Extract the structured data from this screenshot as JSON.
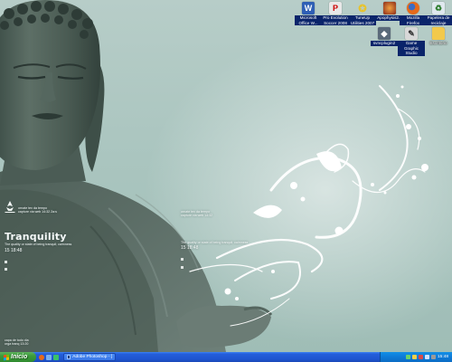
{
  "widgets": {
    "left": {
      "tiny_top_1": "ornate tex da tempo",
      "tiny_top_2": "capture via web 14:32 2a:s",
      "title": "Tranquility",
      "subtitle": "The quality or state of being tranquil; calmness",
      "clock": "15  18:48",
      "tiny_bottom_1": "capa de todo dia",
      "tiny_bottom_2": "orga tranq 13:20"
    },
    "mid": {
      "tiny_top_1": "ornate tex da tempo",
      "tiny_top_2": "capture via web 14:32",
      "subtitle": "The quality or state of being tranquil; calmness",
      "clock": "15  18:48"
    }
  },
  "desktop_icons": [
    {
      "id": "msoffice",
      "label": "Microsoft Office W...",
      "icon": "word-icon",
      "color": "#2f5fb5"
    },
    {
      "id": "pes",
      "label": "Pro Evolution Soccer 2008",
      "icon": "pes-icon",
      "color": "#e8e8e8"
    },
    {
      "id": "tuneup",
      "label": "TuneUp Utilities 2007",
      "icon": "tuneup-icon",
      "color": "#e8c32a"
    },
    {
      "id": "apophysis",
      "label": "Apophysis2...",
      "icon": "apophysis-icon",
      "color": "#8b2a1a"
    },
    {
      "id": "firefox",
      "label": "Mozilla Firefox",
      "icon": "firefox-icon",
      "color": "#e66a1a"
    },
    {
      "id": "recycle",
      "label": "Papelera de reciclaje",
      "icon": "recycle-bin-icon",
      "color": "#dfe8ee"
    },
    {
      "id": "svnplugin",
      "label": "svncplugin2",
      "icon": "plugin-icon",
      "color": "#5a6a7a"
    },
    {
      "id": "gamegraphic",
      "label": "Game Graphic Studio",
      "icon": "game-graphic-icon",
      "color": "#d8d8d8"
    },
    {
      "id": "escritorio",
      "label": "Escritorio",
      "icon": "folder-icon",
      "color": "#f2c94c"
    }
  ],
  "taskbar": {
    "start_label": "Inicio",
    "task_label": "Adobe Photoshop - [",
    "clock": "15:48"
  },
  "colors": {
    "xp_blue": "#245edb",
    "start_green": "#3c9a3b",
    "tray_blue": "#0e7ad6",
    "icon_selection": "#0a246a"
  }
}
